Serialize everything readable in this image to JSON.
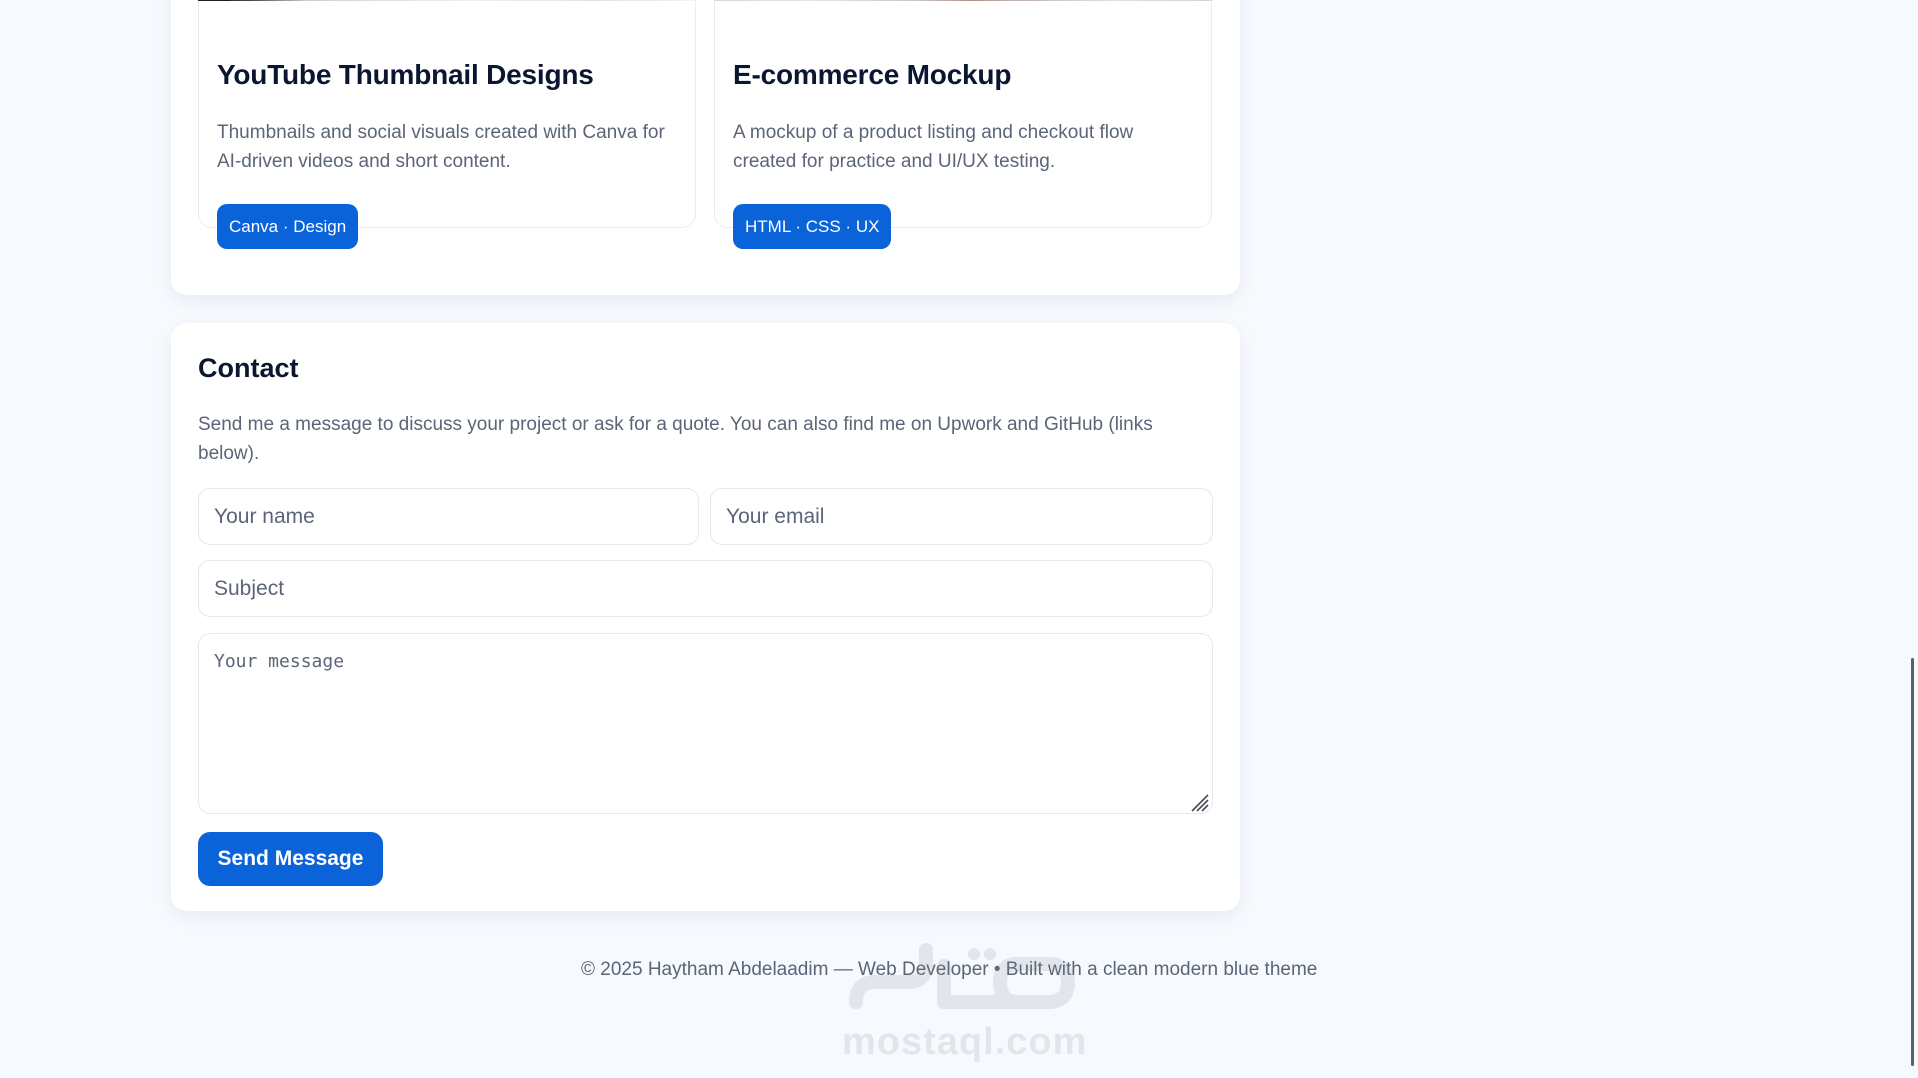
{
  "projects": [
    {
      "title": "YouTube Thumbnail Designs",
      "description": "Thumbnails and social visuals created with Canva for AI-driven videos and short content.",
      "tag": "Canva · Design",
      "image": "laptop-keyboard-photo"
    },
    {
      "title": "E-commerce Mockup",
      "description": "A mockup of a product listing and checkout flow created for practice and UI/UX testing.",
      "tag": "HTML · CSS · UX",
      "image": "fabric-photo"
    }
  ],
  "contact": {
    "title": "Contact",
    "description": "Send me a message to discuss your project or ask for a quote. You can also find me on Upwork and GitHub (links below).",
    "name_placeholder": "Your name",
    "email_placeholder": "Your email",
    "subject_placeholder": "Subject",
    "message_placeholder": "Your message",
    "send_label": "Send Message"
  },
  "footer": {
    "text": "© 2025 Haytham Abdelaadim — Web Developer • Built with a clean modern blue theme"
  },
  "watermark": {
    "text": "mostaql.com"
  },
  "colors": {
    "accent": "#0b63d9",
    "page_background": "#f6f9fd",
    "card_background": "#ffffff",
    "heading": "#0b1730",
    "muted_text": "#5b6577"
  },
  "icons": [
    "resize-grip-icon",
    "mostaql-logo-icon"
  ]
}
